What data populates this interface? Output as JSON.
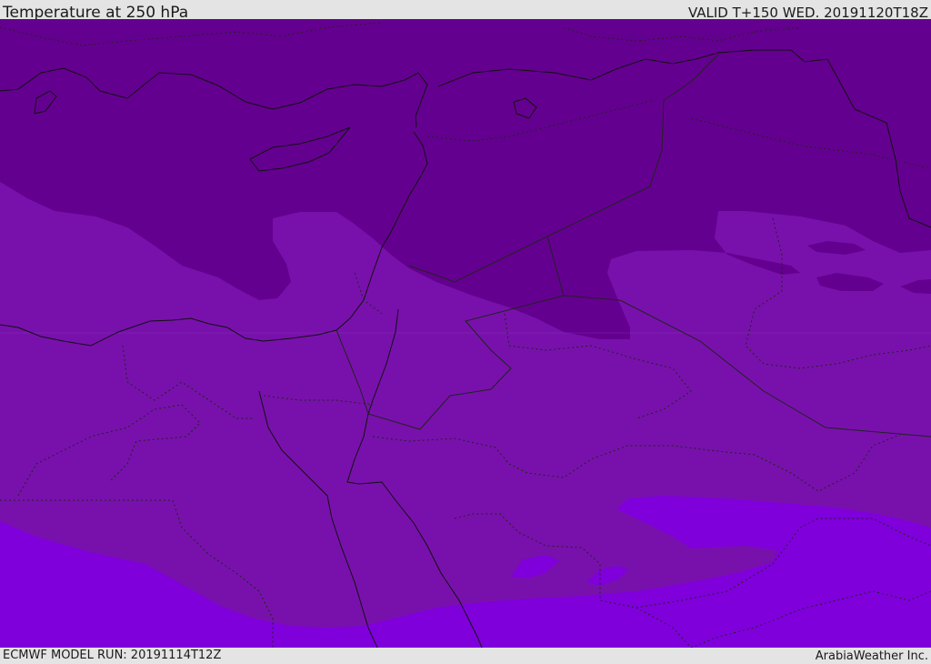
{
  "header": {
    "title": "Temperature at 250 hPa",
    "valid": "VALID T+150 WED. 20191120T18Z"
  },
  "footer": {
    "model_run": "ECMWF MODEL RUN: 20191114T12Z",
    "credit": "ArabiaWeather Inc."
  },
  "map": {
    "colors": {
      "coldest_band": "#64008f",
      "middle_band": "#7811ab",
      "warmest_band": "#7f00db",
      "coastline": "#111111",
      "border": "#222222"
    }
  }
}
